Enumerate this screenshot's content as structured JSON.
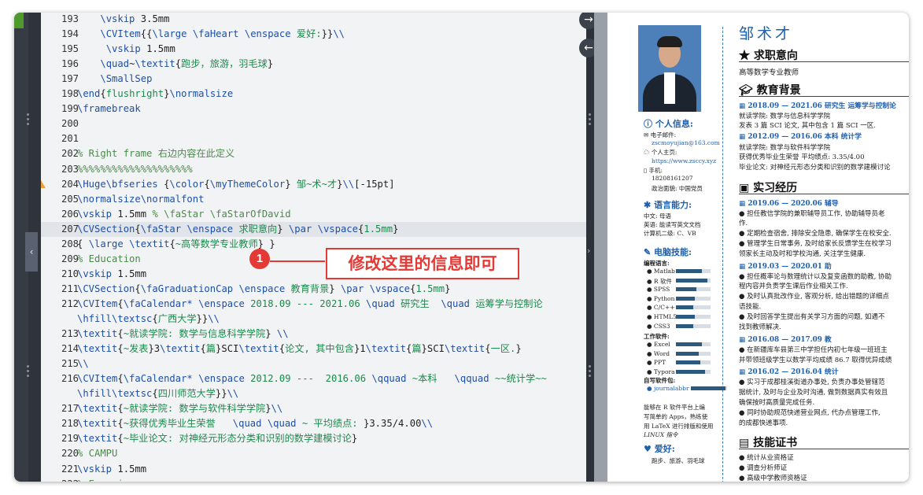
{
  "editor": {
    "lines": [
      {
        "n": "193",
        "code": "    \\vskip 3.5mm"
      },
      {
        "n": "194",
        "code": "    \\CVItem{{\\large \\faHeart \\enspace 爱好:}}\\\\"
      },
      {
        "n": "195",
        "code": "     \\vskip 1.5mm"
      },
      {
        "n": "196",
        "code": "    \\quad~\\textit{跑步，旅游，羽毛球}"
      },
      {
        "n": "197",
        "code": "    \\SmallSep"
      },
      {
        "n": "198",
        "code": "\\end{flushright}\\normalsize"
      },
      {
        "n": "199",
        "code": "\\framebreak"
      },
      {
        "n": "200",
        "code": ""
      },
      {
        "n": "201",
        "code": ""
      },
      {
        "n": "202",
        "code": "% Right frame 右边内容在此定义"
      },
      {
        "n": "203",
        "code": "%%%%%%%%%%%%%%%%%%%%"
      },
      {
        "n": "204",
        "code": "\\Huge\\bfseries {\\color{\\myThemeColor} 邹~术~才}\\\\[-15pt]",
        "warning": true
      },
      {
        "n": "205",
        "code": "\\normalsize\\normalfont"
      },
      {
        "n": "206",
        "code": "\\vskip 1.5mm % \\faStar \\faStarOfDavid"
      },
      {
        "n": "207",
        "code": "\\CVSection{\\faStar \\enspace 求职意向} \\par \\vspace{1.5mm}",
        "active": true
      },
      {
        "n": "208",
        "code": "{ \\large \\textit{~高等数学专业教师} }"
      },
      {
        "n": "209",
        "code": "% Education"
      },
      {
        "n": "210",
        "code": "\\vskip 1.5mm"
      },
      {
        "n": "211",
        "code": "\\CVSection{\\faGraduationCap \\enspace 教育背景} \\par \\vspace{1.5mm}"
      },
      {
        "n": "212",
        "code": "\\CVItem{\\faCalendar* \\enspace 2018.09 --- 2021.06 \\quad 研究生  \\quad 运筹学与控制论"
      },
      {
        "n": "",
        "code": "\\hfill\\textsc{广西大学}}\\\\"
      },
      {
        "n": "213",
        "code": "\\textit{~就读学院: 数学与信息科学学院} \\\\"
      },
      {
        "n": "214",
        "code": "\\textit{~发表}3\\textit{篇}SCI\\textit{论文, 其中包含}1\\textit{篇}SCI\\textit{一区.}"
      },
      {
        "n": "215",
        "code": "\\\\"
      },
      {
        "n": "216",
        "code": "\\CVItem{\\faCalendar* \\enspace 2012.09 ---  2016.06 \\qquad ~本科   \\qquad ~~统计学~~"
      },
      {
        "n": "",
        "code": "\\hfill\\textsc{四川师范大学}}\\\\"
      },
      {
        "n": "217",
        "code": "\\textit{~就读学院: 数学与软件科学学院}\\\\"
      },
      {
        "n": "218",
        "code": "\\textit{~获得优秀毕业生荣誉   \\quad \\quad ~ 平均绩点: }3.35/4.00\\\\"
      },
      {
        "n": "219",
        "code": "\\textit{~毕业论文: 对神经元形态分类和识别的数学建模讨论}"
      },
      {
        "n": "220",
        "code": "% CAMPU"
      },
      {
        "n": "221",
        "code": "\\vskip 1.5mm"
      },
      {
        "n": "222",
        "code": "% Experi"
      }
    ]
  },
  "annotation": {
    "number": "1",
    "text": "修改这里的信息即可"
  },
  "nav": {
    "forward": "→",
    "back": "←",
    "collapse_left": "‹",
    "collapse_right": "›"
  },
  "preview": {
    "name": "邹术才",
    "sidebar": {
      "personal_title": "个人信息:",
      "email_label": "电子邮件:",
      "email": "zscmoyujian@163.com",
      "homepage_label": "个人主页:",
      "homepage": "https://www.zsccy.xyz",
      "phone_label": "手机:",
      "phone": "18208161207",
      "politics": "政治面貌:  中国党员",
      "lang_title": "语言能力:",
      "lang_cn": "中文: 母语",
      "lang_en": "英语: 能读写英文文档",
      "lang_cert": "计算机二级: C、VB",
      "pc_title": "电脑技能:",
      "prog_label": "编程语言:",
      "prog": [
        {
          "name": "Matlab",
          "level": 0.75
        },
        {
          "name": "R 软件",
          "level": 0.9
        },
        {
          "name": "SPSS",
          "level": 0.6
        },
        {
          "name": "Python",
          "level": 0.55
        },
        {
          "name": "C/C++",
          "level": 0.5
        },
        {
          "name": "HTML5",
          "level": 0.55
        },
        {
          "name": "CSS3",
          "level": 0.5
        }
      ],
      "office_label": "工作软件:",
      "office": [
        {
          "name": "Excel",
          "level": 0.75
        },
        {
          "name": "Word",
          "level": 0.65
        },
        {
          "name": "PPT",
          "level": 0.7
        },
        {
          "name": "Typora",
          "level": 0.85
        }
      ],
      "self_label": "自写软件包:",
      "self_pkg": "journalabbr",
      "self_level": 0.95,
      "note1": "能够在 R 软件平台上编",
      "note2": "写简单的 Apps，熟练使",
      "note3": "用 LaTeX 进行排版和使用",
      "note4": "LINUX 指令",
      "hobby_title": "爱好:",
      "hobby": "跑步、旅游、羽毛球"
    },
    "main": {
      "objective_title": "求职意向",
      "objective": "高等数学专业教师",
      "edu_title": "教育背景",
      "edu1_head": "2018.09 — 2021.06   研究生   运筹学与控制论",
      "edu1_l1": "就读学院: 数学与信息科学学院",
      "edu1_l2": "发表 3 篇 SCI 论文, 其中包含 1 篇 SCI 一区.",
      "edu2_head": "2012.09 — 2016.06      本科      统计学",
      "edu2_l1": "就读学院: 数学与软件科学学院",
      "edu2_l2": "获得优秀毕业生荣誉       平均绩点: 3.35/4.00",
      "edu2_l3": "毕业论文: 对神经元形态分类和识别的数学建模讨论",
      "exp_title": "实习经历",
      "exp1_head": "2019.06 — 2020.06                    辅导",
      "exp1_l1": "● 担任教信学院的兼职辅导员工作, 协助辅导员老",
      "exp1_l2": "作.",
      "exp1_l3": "● 定期检查宿舍, 排除安全隐患, 确保学生在校安全.",
      "exp1_l4": "● 管理学生日常事务, 及时给家长反馈学生在校学习",
      "exp1_l5": "领家长主动及时和学校沟通, 关注学生健康.",
      "exp2_head": "2019.03 — 2020.01                          助",
      "exp2_l1": "● 担任概率论与数理统计以及复变函数的助教, 协助",
      "exp2_l2": "程内容并负责学生课后作业相关工作.",
      "exp2_l3": "● 及时认真批改作业, 客观分析, 给出错题的详细点",
      "exp2_l4": "语技能.",
      "exp2_l5": "● 及时回答学生提出有关学习方面的问题, 如遇不",
      "exp2_l6": "找到教师解决.",
      "exp3_head": "2016.08 — 2017.09                            教",
      "exp3_l1": "● 在新疆库车县第三中学担任内初七年级一班班主",
      "exp3_l2": "并带领班级学生以数学平均成绩 86.7 取得优异成绩",
      "exp4_head": "2016.02 — 2016.04                          统计",
      "exp4_l1": "● 实习于成都桂溪街道办事处, 负责办事处管辖范",
      "exp4_l2": "据统计, 及时与企业及时沟通, 做到数据真实有效且",
      "exp4_l3": "确保按时高质量完成任务.",
      "exp4_l4": "● 同时协助规范快递营业网点, 代办点管理工作,",
      "exp4_l5": "的成都快递事项.",
      "cert_title": "技能证书",
      "cert1": "● 统计从业资格证",
      "cert2": "● 调查分析师证",
      "cert3": "● 高级中学教师资格证"
    }
  },
  "colors": {
    "accent": "#1e5fae",
    "annotation": "#e53935",
    "editor_bg": "#f2f3f5"
  }
}
